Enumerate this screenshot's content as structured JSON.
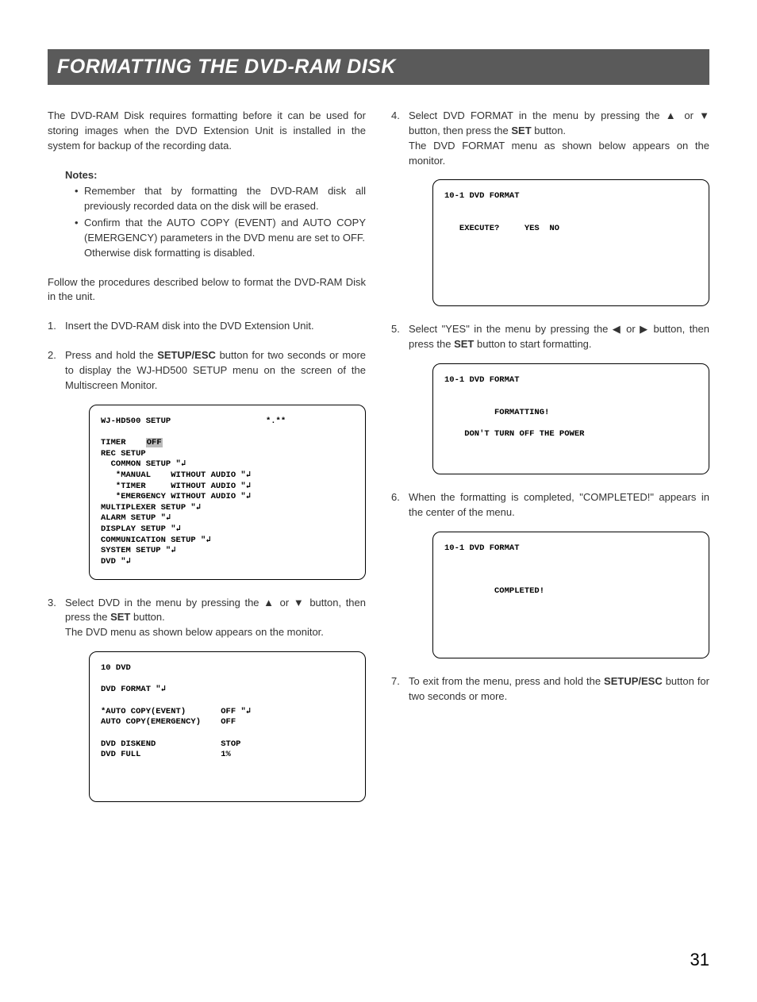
{
  "title": "FORMATTING THE DVD-RAM DISK",
  "intro": "The DVD-RAM Disk requires formatting before it can be used for storing images when the DVD Extension Unit is installed in the system for backup of the recording data.",
  "notes_heading": "Notes:",
  "note1": "Remember that by formatting the DVD-RAM disk all previously recorded data on the disk will be erased.",
  "note2": "Confirm that the AUTO COPY (EVENT) and AUTO COPY (EMERGENCY) parameters in the DVD menu are set to OFF.",
  "note2b": "Otherwise disk formatting is disabled.",
  "follow": "Follow the procedures described below to format the DVD-RAM Disk in the unit.",
  "step1": "Insert the DVD-RAM disk into the DVD Extension Unit.",
  "step2a": "Press and hold the ",
  "step2b": "SETUP/ESC",
  "step2c": " button for two seconds or more to display the WJ-HD500 SETUP menu on the screen of the Multiscreen Monitor.",
  "step3a": "Select DVD in the menu by pressing the ",
  "step3b": " or ",
  "step3c": " button, then press the ",
  "step3d": "SET",
  "step3e": " button.",
  "step3f": "The DVD menu as shown below appears on the monitor.",
  "step4a": "Select DVD FORMAT in the menu by pressing the ",
  "step4b": " or ",
  "step4c": " button, then press the ",
  "step4d": "SET",
  "step4e": " button.",
  "step4f": "The DVD FORMAT menu as shown below appears on the monitor.",
  "step5a": "Select \"YES\" in the menu by pressing the ",
  "step5b": " or ",
  "step5c": " button, then press the ",
  "step5d": "SET",
  "step5e": " button to start formatting.",
  "step6": "When the formatting is completed, \"COMPLETED!\" appears in the center of the menu.",
  "step7a": "To exit from the menu, press and hold the ",
  "step7b": "SETUP/ESC",
  "step7c": " button for two seconds or more.",
  "menu1": {
    "header_left": "WJ-HD500 SETUP",
    "header_right": "*.**",
    "l1": "TIMER    ",
    "l1_hl": "OFF",
    "l2": "REC SETUP",
    "l3": "  COMMON SETUP \"↲",
    "l4": "   *MANUAL    WITHOUT AUDIO \"↲",
    "l5": "   *TIMER     WITHOUT AUDIO \"↲",
    "l6": "   *EMERGENCY WITHOUT AUDIO \"↲",
    "l7": "MULTIPLEXER SETUP \"↲",
    "l8": "ALARM SETUP \"↲",
    "l9": "DISPLAY SETUP \"↲",
    "l10": "COMMUNICATION SETUP \"↲",
    "l11": "SYSTEM SETUP \"↲",
    "l12": "DVD \"↲"
  },
  "menu2": {
    "header": "10 DVD",
    "l1": "DVD FORMAT \"↲",
    "l2a": "*AUTO COPY(EVENT)",
    "l2b": "OFF \"↲",
    "l3a": "AUTO COPY(EMERGENCY)",
    "l3b": "OFF",
    "l4a": "DVD DISKEND",
    "l4b": "STOP",
    "l5a": "DVD FULL",
    "l5b": "1%"
  },
  "menu3": {
    "header": "10-1 DVD FORMAT",
    "l1": "   EXECUTE?     YES  NO"
  },
  "menu4": {
    "header": "10-1 DVD FORMAT",
    "l1": "          FORMATTING!",
    "l2": "    DON'T TURN OFF THE POWER"
  },
  "menu5": {
    "header": "10-1 DVD FORMAT",
    "l1": "          COMPLETED!"
  },
  "page_num": "31",
  "arrows": {
    "up": "▲",
    "down": "▼",
    "left": "◀",
    "right": "▶"
  }
}
